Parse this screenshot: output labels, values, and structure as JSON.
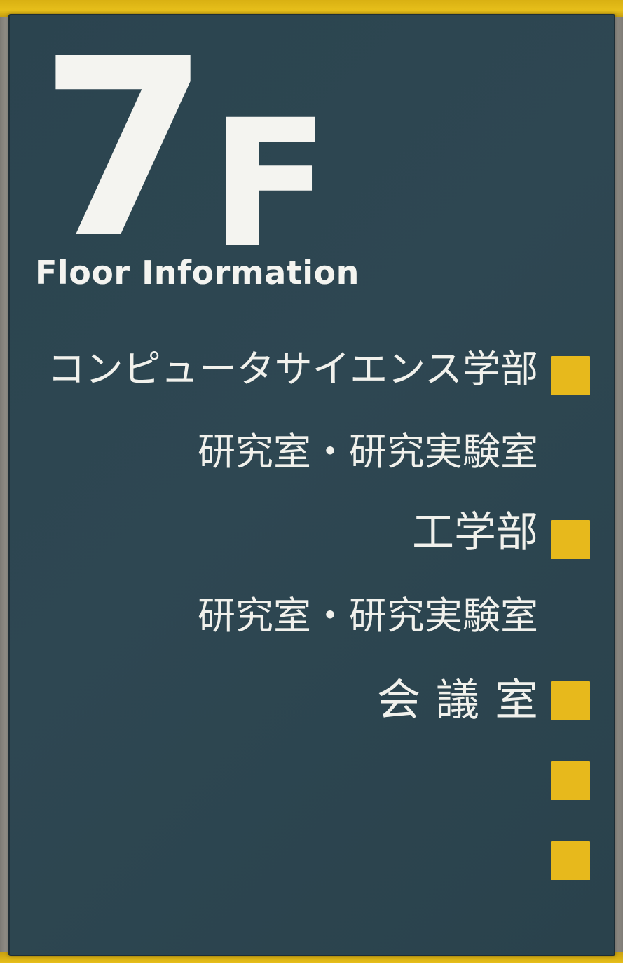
{
  "sign": {
    "floor_number": "7",
    "floor_unit": "F",
    "floor_label": "Floor Information",
    "entries": [
      {
        "text": "コンピュータサイエンス学部",
        "marker": true
      },
      {
        "text": "研究室・研究実験室",
        "marker": false
      },
      {
        "text": "工学部",
        "marker": true
      },
      {
        "text": "研究室・研究実験室",
        "marker": false
      },
      {
        "text": "会議室",
        "marker": true
      }
    ],
    "extra_markers": 2
  },
  "colors": {
    "panel": "#2e4752",
    "accent": "#e7b91c",
    "text": "#f4f4f0"
  }
}
